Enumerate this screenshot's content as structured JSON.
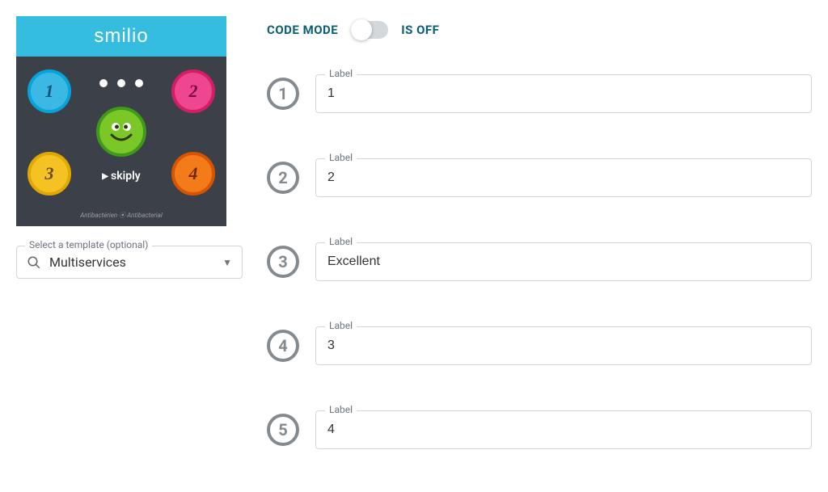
{
  "device": {
    "brand": "smilio",
    "buttons": {
      "b1": "1",
      "b2": "2",
      "b3": "3",
      "b4": "4"
    },
    "skiply": "skiply",
    "anti": "Antibactérien ⦿ Antibacterial"
  },
  "template": {
    "legend": "Select a template (optional)",
    "value": "Multiservices"
  },
  "codeMode": {
    "label": "CODE MODE",
    "state": "IS OFF",
    "on": false
  },
  "labels": [
    {
      "num": "1",
      "field_label": "Label",
      "value": "1"
    },
    {
      "num": "2",
      "field_label": "Label",
      "value": "2"
    },
    {
      "num": "3",
      "field_label": "Label",
      "value": "Excellent"
    },
    {
      "num": "4",
      "field_label": "Label",
      "value": "3"
    },
    {
      "num": "5",
      "field_label": "Label",
      "value": "4"
    }
  ]
}
